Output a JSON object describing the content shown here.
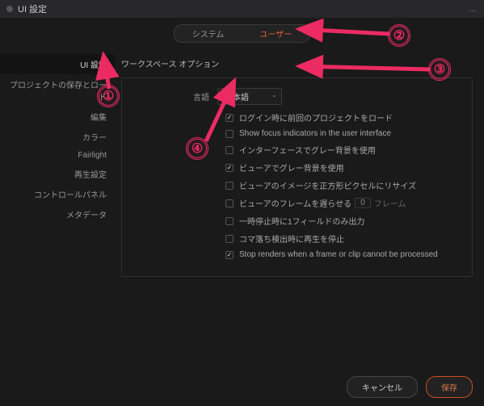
{
  "window": {
    "title": "UI 設定",
    "more": "…"
  },
  "topTabs": {
    "system": "システム",
    "user": "ユーザー"
  },
  "sidebar": {
    "items": [
      "UI 設定",
      "プロジェクトの保存とロード",
      "編集",
      "カラー",
      "Fairlight",
      "再生設定",
      "コントロールパネル",
      "メタデータ"
    ]
  },
  "subTitle": "ワークスペース オプション",
  "lang": {
    "label": "言語",
    "value": "日本語"
  },
  "checks": [
    {
      "on": true,
      "label": "ログイン時に前回のプロジェクトをロード"
    },
    {
      "on": false,
      "label": "Show focus indicators in the user interface"
    },
    {
      "on": false,
      "label": "インターフェースでグレー背景を使用"
    },
    {
      "on": true,
      "label": "ビューアでグレー背景を使用"
    },
    {
      "on": false,
      "label": "ビューアのイメージを正方形ピクセルにリサイズ"
    },
    {
      "on": false,
      "label": "ビューアのフレームを遅らせる",
      "num": "0",
      "suffix": "フレーム"
    },
    {
      "on": false,
      "label": "一時停止時に1フィールドのみ出力"
    },
    {
      "on": false,
      "label": "コマ落ち検出時に再生を停止"
    },
    {
      "on": true,
      "label": "Stop renders when a frame or clip cannot be processed"
    }
  ],
  "footer": {
    "cancel": "キャンセル",
    "save": "保存"
  },
  "ann": {
    "1": "①",
    "2": "②",
    "3": "③",
    "4": "④"
  }
}
